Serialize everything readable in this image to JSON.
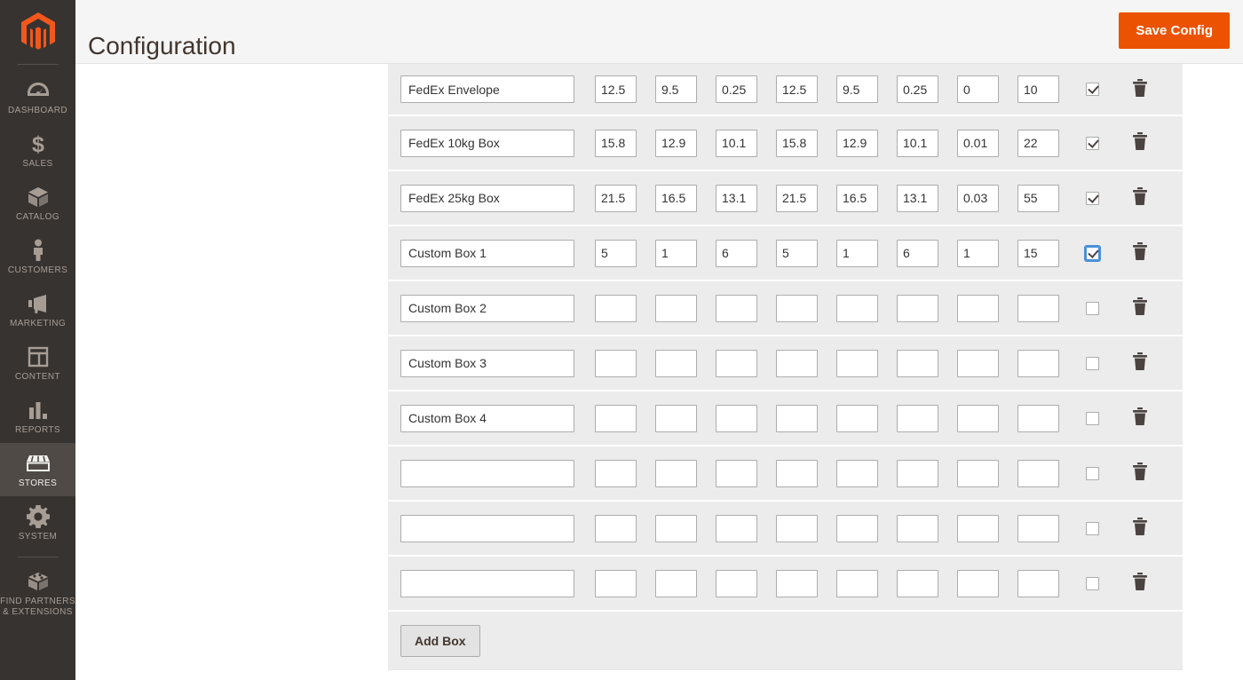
{
  "app": {
    "logo_icon": "magento-logo-icon",
    "accent_color": "#eb5202",
    "sidebar_bg": "#373330"
  },
  "sidebar": {
    "items": [
      {
        "label": "DASHBOARD",
        "icon": "dashboard-gauge-icon",
        "active": false
      },
      {
        "label": "SALES",
        "icon": "dollar-sign-icon",
        "active": false
      },
      {
        "label": "CATALOG",
        "icon": "catalog-box-icon",
        "active": false
      },
      {
        "label": "CUSTOMERS",
        "icon": "customers-person-icon",
        "active": false
      },
      {
        "label": "MARKETING",
        "icon": "marketing-megaphone-icon",
        "active": false
      },
      {
        "label": "CONTENT",
        "icon": "content-layout-icon",
        "active": false
      },
      {
        "label": "REPORTS",
        "icon": "reports-bars-icon",
        "active": false
      },
      {
        "label": "STORES",
        "icon": "stores-awning-icon",
        "active": true
      },
      {
        "label": "SYSTEM",
        "icon": "system-gear-icon",
        "active": false
      },
      {
        "label": "FIND PARTNERS\n& EXTENSIONS",
        "icon": "extensions-brick-icon",
        "active": false
      }
    ]
  },
  "header": {
    "title": "Configuration",
    "save_label": "Save Config"
  },
  "boxes_table": {
    "add_box_label": "Add Box",
    "delete_icon": "trash-icon",
    "name_placeholder": "",
    "rows": [
      {
        "name": "FedEx Envelope",
        "values": [
          "12.5",
          "9.5",
          "0.25",
          "12.5",
          "9.5",
          "0.25",
          "0",
          "10"
        ],
        "enabled": true,
        "focused": false
      },
      {
        "name": "FedEx 10kg Box",
        "values": [
          "15.8",
          "12.9",
          "10.1",
          "15.8",
          "12.9",
          "10.1",
          "0.01",
          "22"
        ],
        "enabled": true,
        "focused": false
      },
      {
        "name": "FedEx 25kg Box",
        "values": [
          "21.5",
          "16.5",
          "13.1",
          "21.5",
          "16.5",
          "13.1",
          "0.03",
          "55"
        ],
        "enabled": true,
        "focused": false
      },
      {
        "name": "Custom Box 1",
        "values": [
          "5",
          "1",
          "6",
          "5",
          "1",
          "6",
          "1",
          "15"
        ],
        "enabled": true,
        "focused": true
      },
      {
        "name": "Custom Box 2",
        "values": [
          "",
          "",
          "",
          "",
          "",
          "",
          "",
          ""
        ],
        "enabled": false,
        "focused": false
      },
      {
        "name": "Custom Box 3",
        "values": [
          "",
          "",
          "",
          "",
          "",
          "",
          "",
          ""
        ],
        "enabled": false,
        "focused": false
      },
      {
        "name": "Custom Box 4",
        "values": [
          "",
          "",
          "",
          "",
          "",
          "",
          "",
          ""
        ],
        "enabled": false,
        "focused": false
      },
      {
        "name": "",
        "values": [
          "",
          "",
          "",
          "",
          "",
          "",
          "",
          ""
        ],
        "enabled": false,
        "focused": false
      },
      {
        "name": "",
        "values": [
          "",
          "",
          "",
          "",
          "",
          "",
          "",
          ""
        ],
        "enabled": false,
        "focused": false
      },
      {
        "name": "",
        "values": [
          "",
          "",
          "",
          "",
          "",
          "",
          "",
          ""
        ],
        "enabled": false,
        "focused": false
      }
    ]
  }
}
